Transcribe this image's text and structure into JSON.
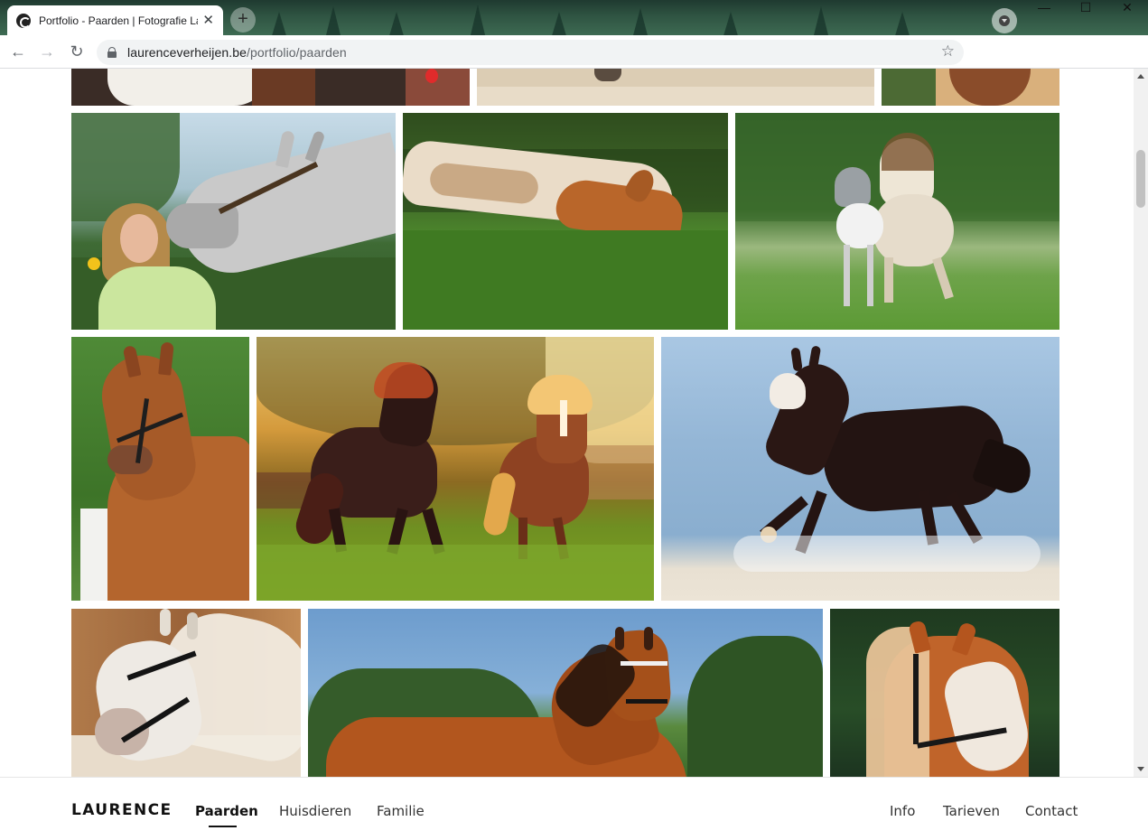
{
  "browser": {
    "tab_title": "Portfolio - Paarden | Fotografie Laurence Verheijen",
    "tab_close": "✕",
    "new_tab": "+",
    "window_controls": {
      "minimize": "—",
      "maximize": "☐",
      "close": "✕"
    },
    "nav": {
      "back": "←",
      "forward": "→",
      "reload": "↻"
    },
    "url_host": "laurenceverheijen.be",
    "url_path": "/portfolio/paarden",
    "bookmark": "☆"
  },
  "icons": [
    "globe-favicon-icon",
    "profile-icon",
    "lock-icon",
    "star-icon"
  ],
  "gallery": {
    "photos": [
      {
        "name": "photo-top-left-partial"
      },
      {
        "name": "photo-top-middle-partial"
      },
      {
        "name": "photo-top-right-partial"
      },
      {
        "name": "photo-woman-kissing-grey-horse"
      },
      {
        "name": "photo-foal-lying-in-grass"
      },
      {
        "name": "photo-mare-and-foal-running"
      },
      {
        "name": "photo-chestnut-horse-portrait"
      },
      {
        "name": "photo-two-ponies-sunset"
      },
      {
        "name": "photo-black-horse-galloping-water"
      },
      {
        "name": "photo-white-horse-flowing-mane"
      },
      {
        "name": "photo-bay-horse-forest-sky"
      },
      {
        "name": "photo-palomino-pony-portrait"
      }
    ]
  },
  "footer": {
    "brand": "LAURENCE",
    "left_links": [
      "Paarden",
      "Huisdieren",
      "Familie"
    ],
    "right_links": [
      "Info",
      "Tarieven",
      "Contact"
    ],
    "active_link": "Paarden"
  }
}
